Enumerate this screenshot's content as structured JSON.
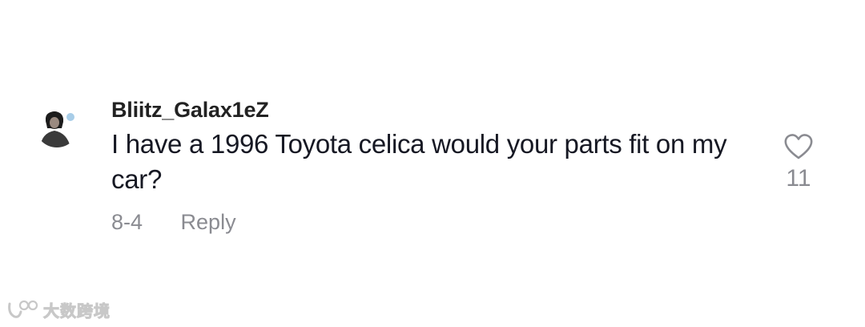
{
  "comment": {
    "username": "Bliitz_Galax1eZ",
    "text": "I have a 1996 Toyota celica would your parts fit on my car?",
    "date": "8-4",
    "reply_label": "Reply",
    "like_count": "11",
    "avatar_icon": "user-avatar",
    "like_icon": "heart-outline-icon"
  },
  "watermark": {
    "text": "大数跨境"
  },
  "colors": {
    "text_primary": "#161823",
    "text_secondary": "#8a8b91",
    "background": "#ffffff"
  }
}
